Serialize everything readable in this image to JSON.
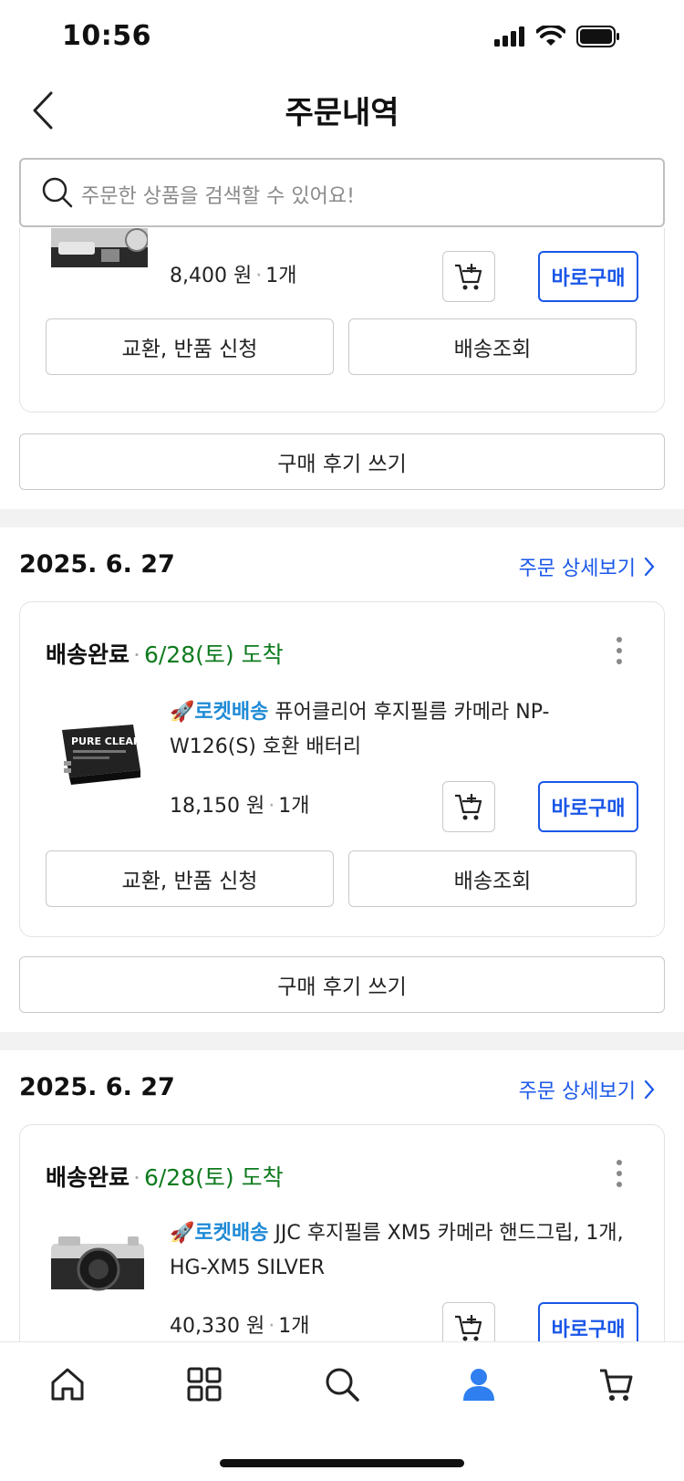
{
  "status_bar": {
    "time": "10:56"
  },
  "header": {
    "title": "주문내역"
  },
  "search": {
    "placeholder": "주문한 상품을 검색할 수 있어요!"
  },
  "orders": [
    {
      "price": "8,400 원",
      "quantity": "1개",
      "buy_now": "바로구매",
      "exchange_label": "교환, 반품 신청",
      "tracking_label": "배송조회",
      "review_label": "구매 후기 쓰기"
    },
    {
      "date": "2025. 6. 27",
      "detail_link": "주문 상세보기",
      "status": "배송완료",
      "arrival": "6/28(토) 도착",
      "rocket_label": "로켓배송",
      "product_name": "퓨어클리어 후지필름 카메라 NP-W126(S) 호환 배터리",
      "thumb_text": "PURE CLEAR",
      "price": "18,150 원",
      "quantity": "1개",
      "buy_now": "바로구매",
      "exchange_label": "교환, 반품 신청",
      "tracking_label": "배송조회",
      "review_label": "구매 후기 쓰기"
    },
    {
      "date": "2025. 6. 27",
      "detail_link": "주문 상세보기",
      "status": "배송완료",
      "arrival": "6/28(토) 도착",
      "rocket_label": "로켓배송",
      "product_name": "JJC 후지필름 XM5 카메라 핸드그립, 1개, HG-XM5 SILVER",
      "price": "40,330 원",
      "quantity": "1개",
      "buy_now": "바로구매"
    }
  ],
  "bottom_nav": [
    "home",
    "categories",
    "search",
    "my-page",
    "cart"
  ],
  "colors": {
    "accent": "#1a57e8",
    "arrival": "#0f7b1f",
    "rocket": "#1f8ad6",
    "active_nav": "#2f7ff0"
  }
}
